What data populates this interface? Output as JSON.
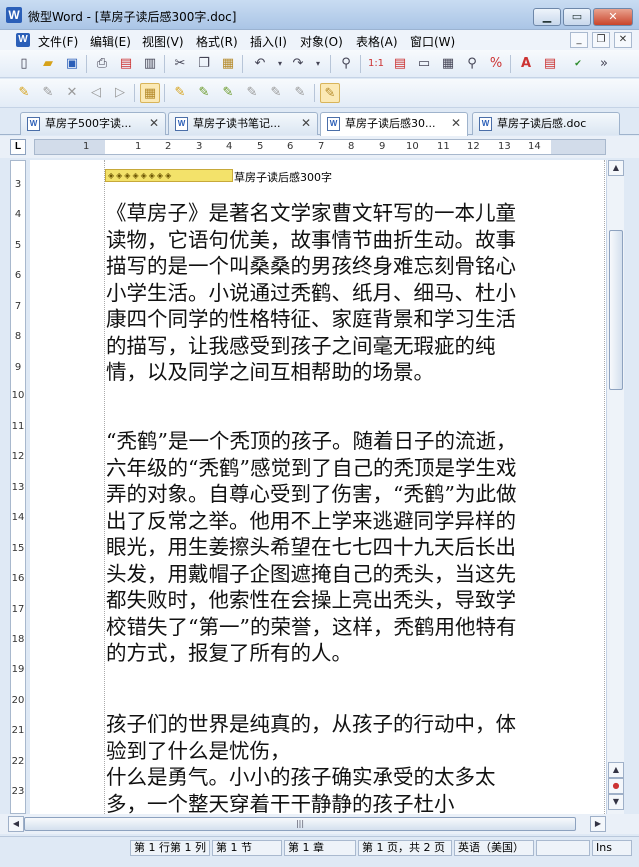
{
  "window": {
    "title": "微型Word - [草房子读后感300字.doc]",
    "app_letter": "W"
  },
  "menu": [
    "文件(F)",
    "编辑(E)",
    "视图(V)",
    "格式(R)",
    "插入(I)",
    "对象(O)",
    "表格(A)",
    "窗口(W)"
  ],
  "tabs": [
    {
      "label": "草房子500字读...",
      "active": false
    },
    {
      "label": "草房子读书笔记...",
      "active": false
    },
    {
      "label": "草房子读后感30...",
      "active": true
    },
    {
      "label": "草房子读后感.doc",
      "active": false
    }
  ],
  "ruler": {
    "corner": "L",
    "h_ticks": [
      "1",
      "1",
      "2",
      "3",
      "4",
      "5",
      "6",
      "7",
      "8",
      "9",
      "10",
      "11",
      "12",
      "13",
      "14"
    ],
    "v_ticks": [
      "3",
      "4",
      "5",
      "6",
      "7",
      "8",
      "9",
      "10",
      "11",
      "12",
      "13",
      "14",
      "15",
      "16",
      "17",
      "18",
      "19",
      "20",
      "21",
      "22",
      "23"
    ]
  },
  "document": {
    "field_marks": "◈◈◈◈◈◈◈◈",
    "header_title": "草房子读后感300字",
    "paragraphs": [
      "《草房子》是著名文学家曹文轩写的一本儿童读物，它语句优美，故事情节曲折生动。故事描写的是一个叫桑桑的男孩终身难忘刻骨铭心小学生活。小说通过秃鹤、纸月、细马、杜小康四个同学的性格特征、家庭背景和学习生活的描写，让我感受到孩子之间毫无瑕疵的纯情，以及同学之间互相帮助的场景。",
      "“秃鹤”是一个秃顶的孩子。随着日子的流逝，六年级的“秃鹤”感觉到了自己的秃顶是学生戏弄的对象。自尊心受到了伤害，“秃鹤”为此做出了反常之举。他用不上学来逃避同学异样的眼光，用生姜擦头希望在七七四十九天后长出头发，用戴帽子企图遮掩自己的秃头，当这先都失败时，他索性在会操上亮出秃头，导致学校错失了“第一”的荣誉，这样，秃鹤用他特有的方式，报复了所有的人。",
      "孩子们的世界是纯真的，从孩子的行动中，体验到了什么是忧伤，",
      "什么是勇气。小小的孩子确实承受的太多太多，一个整天穿着干干静静的孩子杜小"
    ]
  },
  "status": {
    "row_col": "第 1 行第 1 列",
    "section": "第 1 节",
    "chapter": "第 1 章",
    "page": "第 1 页，共 2 页",
    "language": "英语（美国）",
    "mode": "Ins"
  }
}
